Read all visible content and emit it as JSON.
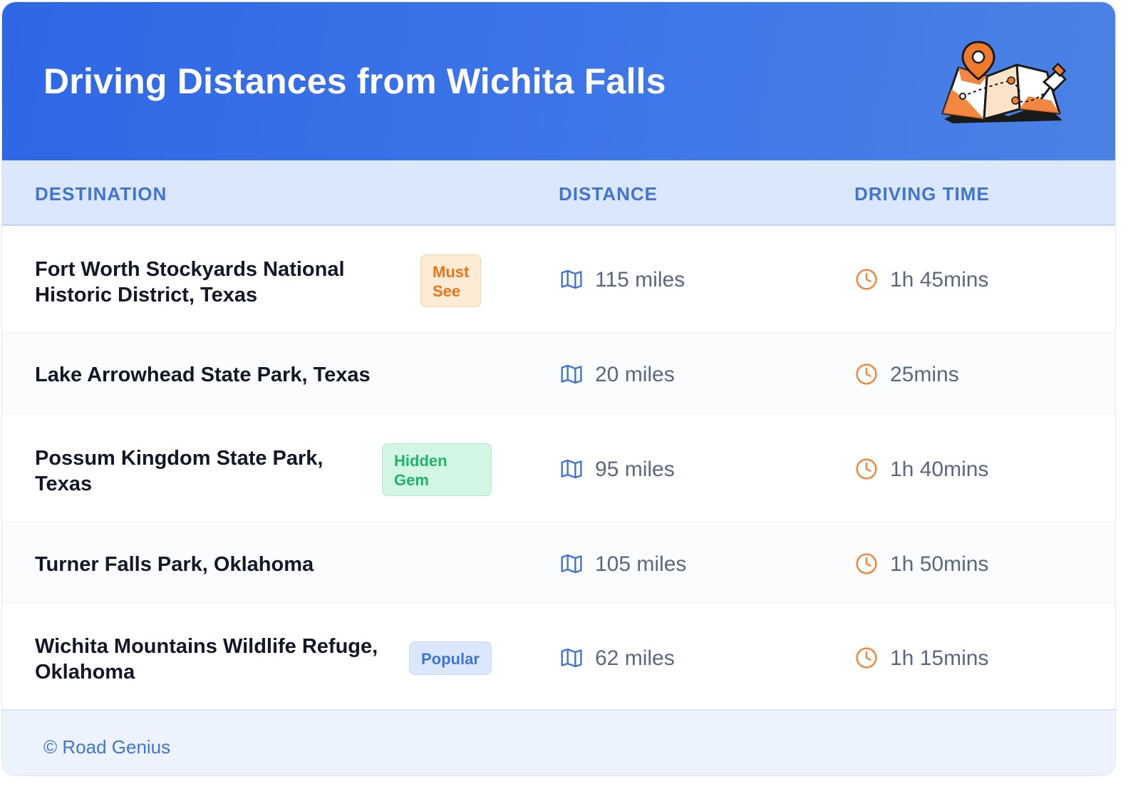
{
  "header": {
    "title": "Driving Distances from Wichita Falls"
  },
  "columns": {
    "destination": "DESTINATION",
    "distance": "DISTANCE",
    "driving_time": "DRIVING TIME"
  },
  "rows": [
    {
      "name_line1": "Fort Worth Stockyards National",
      "name_line2": "Historic District, Texas",
      "badge_line1": "Must",
      "badge_line2": "See",
      "badge_color": "orange",
      "distance": "115 miles",
      "time": "1h 45mins"
    },
    {
      "name_line1": "Lake Arrowhead State Park, Texas",
      "distance": "20 miles",
      "time": "25mins"
    },
    {
      "name_line1": "Possum Kingdom State Park,",
      "name_line2": "Texas",
      "badge_line1": "Hidden",
      "badge_line2": "Gem",
      "badge_color": "green",
      "distance": "95 miles",
      "time": "1h 40mins"
    },
    {
      "name_line1": "Turner Falls Park, Oklahoma",
      "distance": "105 miles",
      "time": "1h 50mins"
    },
    {
      "name_line1": "Wichita Mountains Wildlife Refuge,",
      "name_line2": "Oklahoma",
      "badge_line1": "Popular",
      "badge_color": "blue",
      "distance": "62 miles",
      "time": "1h 15mins"
    }
  ],
  "footer": {
    "credit": "© Road Genius"
  },
  "icons": {
    "distance": "map-icon",
    "time": "clock-icon",
    "header": "map-pin-illustration"
  },
  "colors": {
    "header_blue": "#2f66e6",
    "accent_blue": "#3f74d6",
    "accent_orange": "#ec7419",
    "accent_green": "#1fb46b"
  }
}
